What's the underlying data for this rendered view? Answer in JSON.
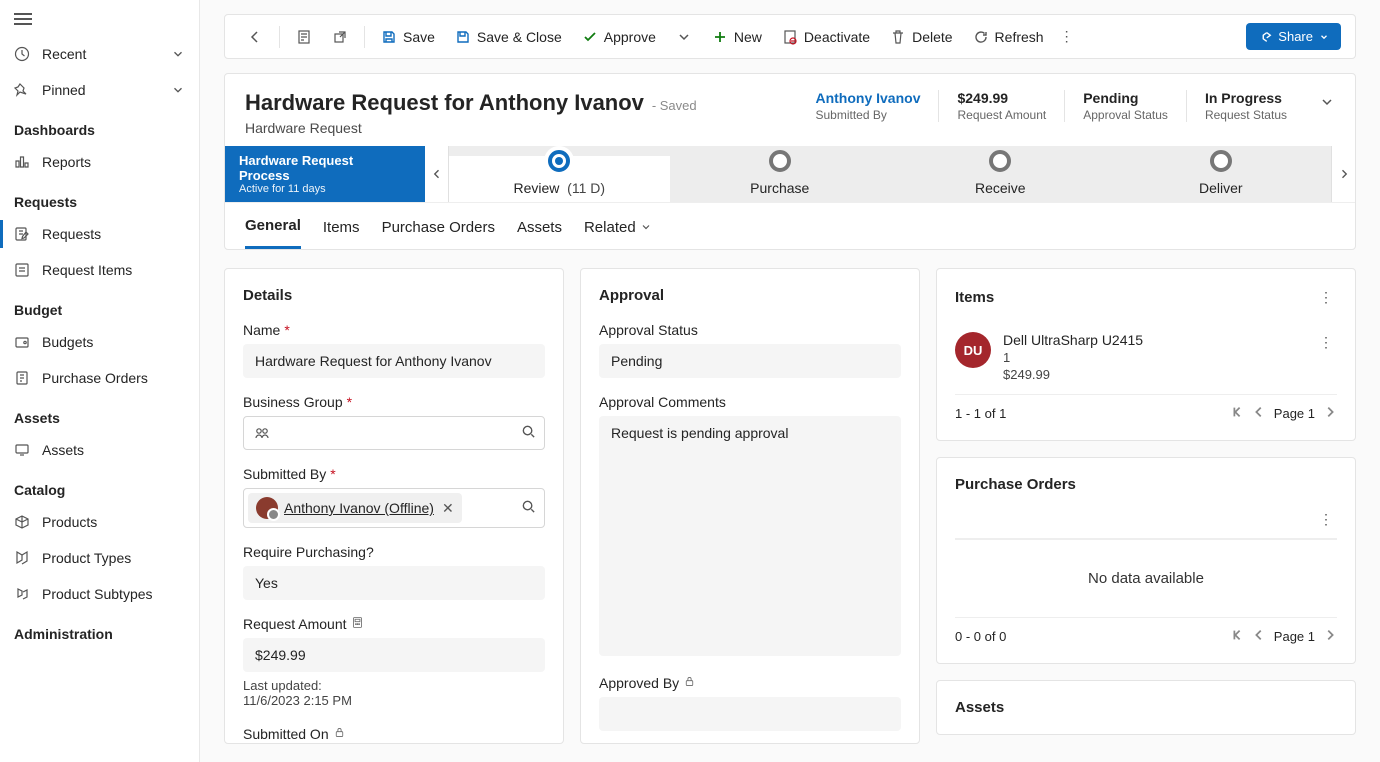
{
  "sidebar": {
    "recent_label": "Recent",
    "pinned_label": "Pinned",
    "sections": {
      "dashboards_header": "Dashboards",
      "reports_label": "Reports",
      "requests_header": "Requests",
      "requests_label": "Requests",
      "request_items_label": "Request Items",
      "budget_header": "Budget",
      "budgets_label": "Budgets",
      "purchase_orders_label": "Purchase Orders",
      "assets_header": "Assets",
      "assets_label": "Assets",
      "catalog_header": "Catalog",
      "products_label": "Products",
      "product_types_label": "Product Types",
      "product_subtypes_label": "Product Subtypes",
      "administration_header": "Administration"
    }
  },
  "cmdbar": {
    "save": "Save",
    "save_close": "Save & Close",
    "approve": "Approve",
    "new": "New",
    "deactivate": "Deactivate",
    "delete": "Delete",
    "refresh": "Refresh",
    "share": "Share"
  },
  "header": {
    "title": "Hardware Request for Anthony Ivanov",
    "saved_suffix": "- Saved",
    "subtitle": "Hardware Request",
    "metrics": {
      "submitted_by_val": "Anthony Ivanov",
      "submitted_by_lbl": "Submitted By",
      "amount_val": "$249.99",
      "amount_lbl": "Request Amount",
      "approval_val": "Pending",
      "approval_lbl": "Approval Status",
      "status_val": "In Progress",
      "status_lbl": "Request Status"
    }
  },
  "process": {
    "name": "Hardware Request Process",
    "duration": "Active for 11 days",
    "stages": {
      "review": "Review",
      "review_days": "(11 D)",
      "purchase": "Purchase",
      "receive": "Receive",
      "deliver": "Deliver"
    }
  },
  "tabs": {
    "general": "General",
    "items": "Items",
    "purchase_orders": "Purchase Orders",
    "assets": "Assets",
    "related": "Related"
  },
  "details": {
    "card_title": "Details",
    "name_label": "Name",
    "name_value": "Hardware Request for Anthony Ivanov",
    "bg_label": "Business Group",
    "submitted_by_label": "Submitted By",
    "submitted_by_value": "Anthony Ivanov (Offline)",
    "require_purchasing_label": "Require Purchasing?",
    "require_purchasing_value": "Yes",
    "amount_label": "Request Amount",
    "amount_value": "$249.99",
    "last_updated_label": "Last updated:",
    "last_updated_value": "11/6/2023 2:15 PM",
    "submitted_on_label": "Submitted On"
  },
  "approval": {
    "card_title": "Approval",
    "status_label": "Approval Status",
    "status_value": "Pending",
    "comments_label": "Approval Comments",
    "comments_value": "Request is pending approval",
    "approved_by_label": "Approved By"
  },
  "items_card": {
    "title": "Items",
    "item_initials": "DU",
    "item_name": "Dell UltraSharp U2415",
    "item_qty": "1",
    "item_price": "$249.99",
    "pager_count": "1 - 1 of 1",
    "pager_page": "Page 1"
  },
  "po_card": {
    "title": "Purchase Orders",
    "no_data": "No data available",
    "pager_count": "0 - 0 of 0",
    "pager_page": "Page 1"
  },
  "assets_card": {
    "title": "Assets"
  }
}
